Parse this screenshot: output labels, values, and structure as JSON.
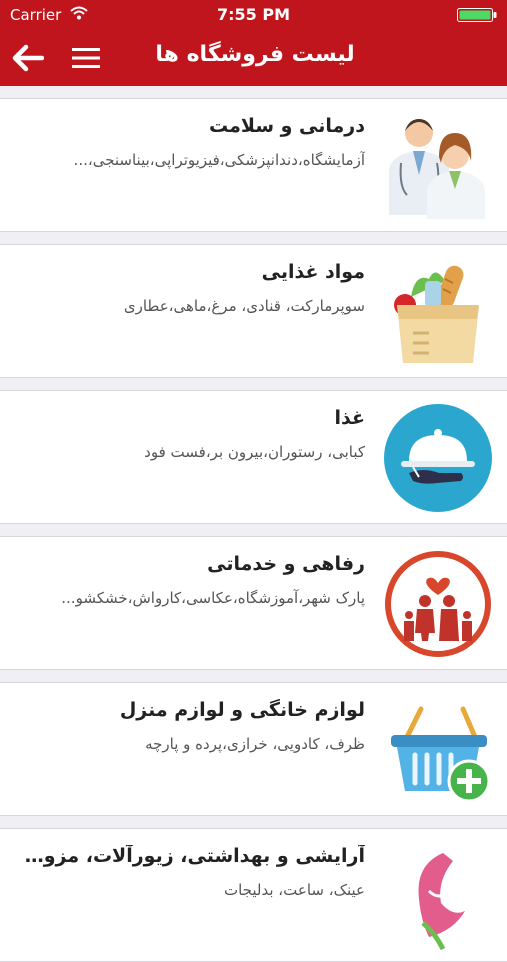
{
  "status_bar": {
    "carrier": "Carrier",
    "time": "7:55 PM"
  },
  "header": {
    "title": "لیست فروشگاه ها"
  },
  "colors": {
    "brand": "#c0151d",
    "background": "#efeff4"
  },
  "stores": [
    {
      "title": "درمانی و سلامت",
      "subtitle": "آزمایشگاه،دندانپزشکی،فیزیوتراپی،بیناسنجی،...",
      "icon": "doctors-icon"
    },
    {
      "title": "مواد غذایی",
      "subtitle": "سوپرمارکت، قنادی، مرغ،ماهی،عطاری",
      "icon": "grocery-bag-icon"
    },
    {
      "title": "غذا",
      "subtitle": "کبابی، رستوران،بیرون بر،فست فود",
      "icon": "food-cloche-icon"
    },
    {
      "title": "رفاهی و خدماتی",
      "subtitle": "پارک شهر،آموزشگاه،عکاسی،کارواش،خشکشو...",
      "icon": "family-icon"
    },
    {
      "title": "لوازم خانگی و لوازم منزل",
      "subtitle": "ظرف، کادویی، خرازی،پرده و پارچه",
      "icon": "basket-add-icon"
    },
    {
      "title": "آرایشی و بهداشتی، زیورآلات، مزون عر...",
      "subtitle": "عینک، ساعت، بدلیجات",
      "icon": "beauty-face-icon"
    }
  ]
}
